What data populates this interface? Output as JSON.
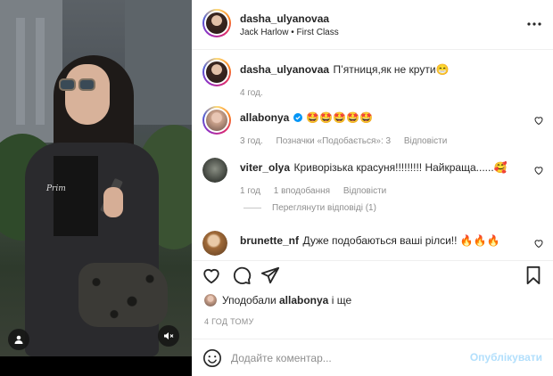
{
  "post": {
    "author": "dasha_ulyanovaa",
    "audio": "Jack Harlow • First Class",
    "shirt_print": "Prim"
  },
  "caption": {
    "username": "dasha_ulyanovaa",
    "text": "П’ятниця,як не крути😁",
    "time": "4 год."
  },
  "comments": [
    {
      "username": "allabonya",
      "verified": true,
      "text": "🤩🤩🤩🤩🤩",
      "time": "3 год.",
      "likes": "Позначки «Подобається»: 3",
      "reply": "Відповісти"
    },
    {
      "username": "viter_olya",
      "text": "Криворізька красуня!!!!!!!!! Найкраща......🥰",
      "time": "1 год",
      "likes": "1 вподобання",
      "reply": "Відповісти"
    },
    {
      "username": "brunette_nf",
      "text": "Дуже подобаються ваші рілси!! 🔥🔥🔥",
      "time": "",
      "likes": "",
      "reply": ""
    }
  ],
  "view_replies": "Переглянути відповіді (1)",
  "liked_by": {
    "prefix": "Уподобали",
    "user": "allabonya",
    "suffix": "і ще"
  },
  "timestamp": "4 ГОД ТОМУ",
  "composer": {
    "placeholder": "Додайте коментар...",
    "post_label": "Опублікувати"
  },
  "colors": {
    "post_button": "#b2dffc",
    "verified": "#0095f6"
  },
  "icons": [
    "more-options-icon",
    "heart-icon",
    "comment-icon",
    "share-icon",
    "bookmark-icon",
    "emoji-icon",
    "user-tag-icon",
    "mute-icon"
  ]
}
